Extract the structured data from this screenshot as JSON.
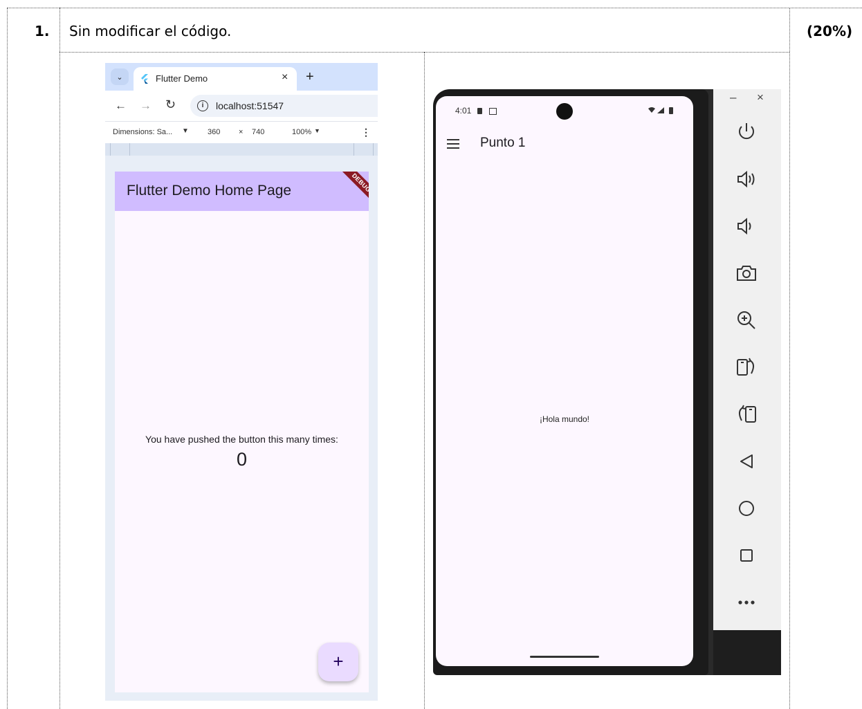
{
  "document": {
    "item_number": "1.",
    "instruction": "Sin modificar el código.",
    "weight": "(20%)"
  },
  "browser": {
    "tab_title": "Flutter Demo",
    "tab_close": "×",
    "new_tab": "+",
    "url": "localhost:51547",
    "devtools": {
      "dimensions_label": "Dimensions: Sa...",
      "dropdown_caret": "▼",
      "width": "360",
      "times": "×",
      "height": "740",
      "zoom": "100%",
      "zoom_caret": "▼",
      "more": "⋮"
    },
    "app": {
      "title": "Flutter Demo Home Page",
      "debug_banner": "DEBUG",
      "message": "You have pushed the button this many times:",
      "counter": "0",
      "fab_label": "+"
    }
  },
  "emulator": {
    "status_time": "4:01",
    "app_title": "Punto 1",
    "body_text": "¡Hola mundo!",
    "window_minimize": "–",
    "window_close": "×",
    "panel_icons": [
      "power-icon",
      "volume-up-icon",
      "volume-down-icon",
      "camera-icon",
      "zoom-in-icon",
      "rotate-right-icon",
      "rotate-left-icon",
      "back-icon",
      "home-icon",
      "overview-icon",
      "more-icon"
    ]
  }
}
